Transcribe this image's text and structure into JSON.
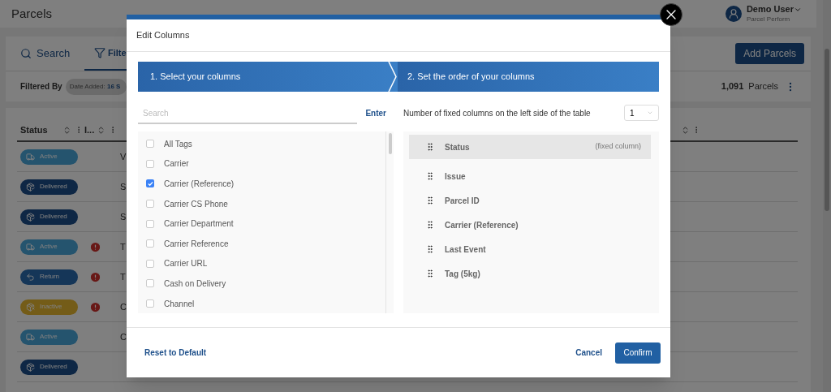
{
  "app": {
    "title": "Parcels",
    "user": {
      "name": "Demo User",
      "org": "Parcel Perform"
    }
  },
  "tabs": [
    {
      "label": "Search",
      "kind": "search",
      "selected": false
    },
    {
      "label": "Filte",
      "kind": "filter",
      "selected": true
    }
  ],
  "add_button": "Add Parcels",
  "filter_bar": {
    "label": "Filtered By",
    "chip_key": "Date Added:",
    "chip_value": "16 S",
    "count": "1,091",
    "count_label": "Parcels"
  },
  "table": {
    "columns": [
      "Status",
      "I..."
    ],
    "rows": [
      {
        "status": "Active",
        "kind": "active",
        "issue": false,
        "column_3": "V"
      },
      {
        "status": "Delivered",
        "kind": "delivered",
        "issue": false,
        "column_3": "S"
      },
      {
        "status": "Delivered",
        "kind": "delivered",
        "issue": false,
        "column_3": "S"
      },
      {
        "status": "Active",
        "kind": "active",
        "issue": true,
        "column_3": "T"
      },
      {
        "status": "Return",
        "kind": "return",
        "issue": true,
        "column_3": "T"
      },
      {
        "status": "Inactive",
        "kind": "inactive",
        "issue": true,
        "column_3": "C"
      },
      {
        "status": "Active",
        "kind": "active",
        "issue": false,
        "column_3": "C"
      },
      {
        "status": "Delivered",
        "kind": "delivered",
        "issue": false
      }
    ]
  },
  "modal": {
    "title": "Edit Columns",
    "steps": [
      "1. Select your columns",
      "2. Set the order of your columns"
    ],
    "search": {
      "placeholder": "Search",
      "button": "Enter"
    },
    "columns": [
      {
        "label": "All Tags",
        "checked": false
      },
      {
        "label": "Carrier",
        "checked": false
      },
      {
        "label": "Carrier (Reference)",
        "checked": true
      },
      {
        "label": "Carrier CS Phone",
        "checked": false
      },
      {
        "label": "Carrier Department",
        "checked": false
      },
      {
        "label": "Carrier Reference",
        "checked": false
      },
      {
        "label": "Carrier URL",
        "checked": false
      },
      {
        "label": "Cash on Delivery",
        "checked": false
      },
      {
        "label": "Channel",
        "checked": false
      }
    ],
    "fixed_label": "Number of fixed columns on the left side of the table",
    "fixed_count": "1",
    "order": [
      {
        "label": "Status",
        "note": "(fixed column)",
        "fixed": true
      },
      {
        "label": "Issue",
        "fixed": false
      },
      {
        "label": "Parcel ID",
        "fixed": false
      },
      {
        "label": "Carrier (Reference)",
        "fixed": false
      },
      {
        "label": "Last Event",
        "fixed": false
      },
      {
        "label": "Tag (5kg)",
        "fixed": false
      }
    ],
    "footer": {
      "reset": "Reset to Default",
      "cancel": "Cancel",
      "confirm": "Confirm"
    }
  }
}
